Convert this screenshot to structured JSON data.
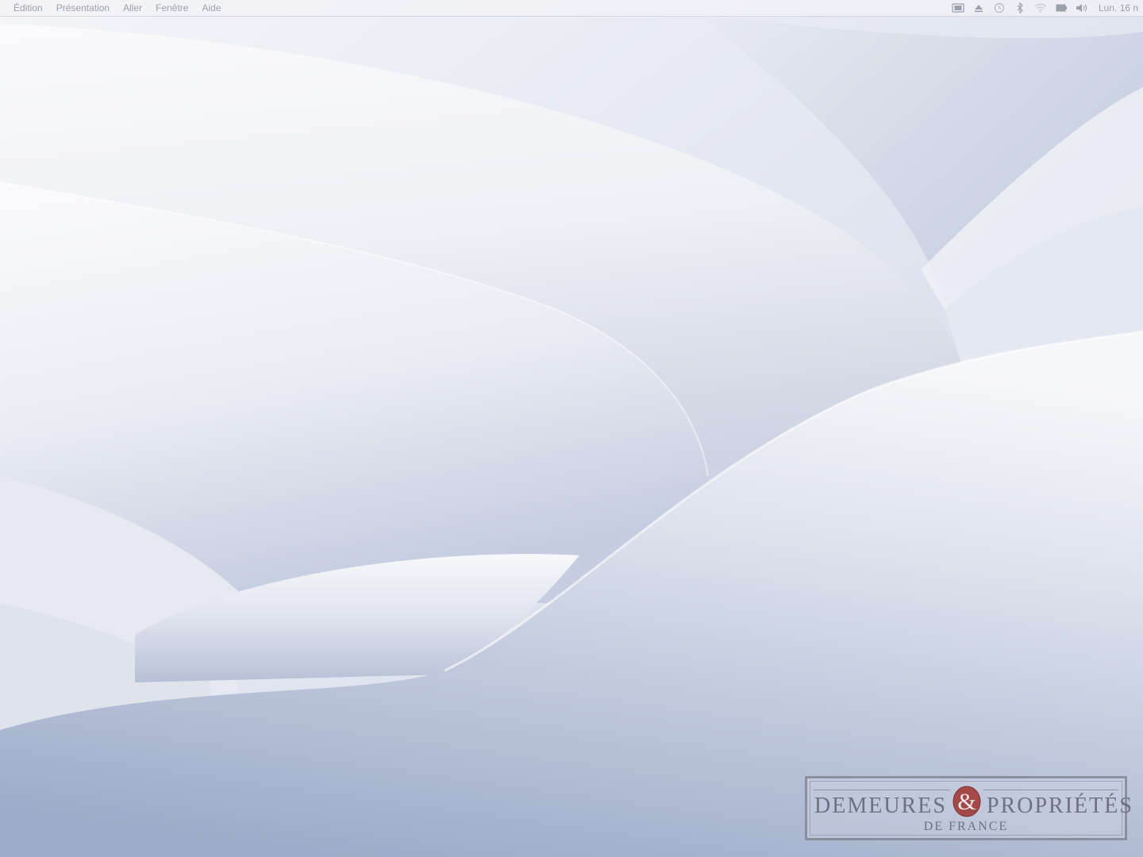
{
  "menubar": {
    "items": [
      {
        "label": "Édition"
      },
      {
        "label": "Présentation"
      },
      {
        "label": "Aller"
      },
      {
        "label": "Fenêtre"
      },
      {
        "label": "Aide"
      }
    ],
    "status_icons": [
      "screen-mirroring-icon",
      "eject-icon",
      "time-machine-icon",
      "bluetooth-icon",
      "wifi-icon",
      "battery-icon",
      "volume-icon"
    ],
    "clock": "Lun. 16 n"
  },
  "logo": {
    "word_left": "DEMEURES",
    "word_right": "PROPRIÉTÉS",
    "subtitle": "DE FRANCE",
    "accent_color": "#a4484a"
  }
}
